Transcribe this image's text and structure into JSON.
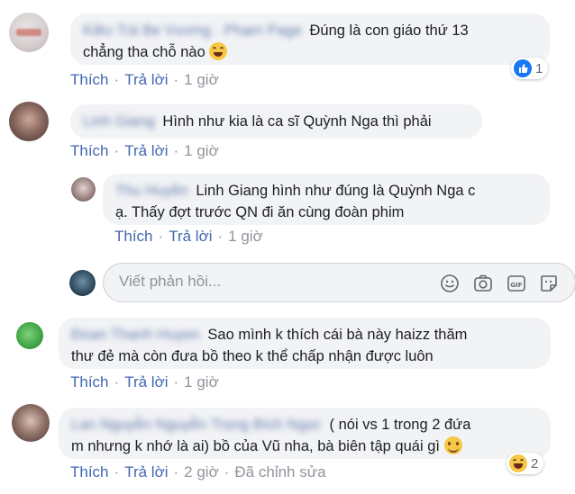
{
  "comments": [
    {
      "author": "Kiều Trà Be Vương · Phạm Page",
      "text_line1": "Đúng là con giáo thứ 13",
      "text_line2": "chẳng tha chỗ nào",
      "actions": {
        "like": "Thích",
        "reply": "Trả lời",
        "time": "1 giờ"
      },
      "reaction": {
        "icon": "like-reaction-icon",
        "count": "1",
        "color": "#1877f2"
      }
    },
    {
      "author": "Linh Giang",
      "text_line1": "Hình như kia là ca sĩ Quỳnh Nga thì phải",
      "actions": {
        "like": "Thích",
        "reply": "Trả lời",
        "time": "1 giờ"
      }
    },
    {
      "author": "Thu Huyền",
      "text_line1": "Linh Giang hình như đúng là Quỳnh Nga c",
      "text_line2": "ạ. Thấy đợt trước QN đi ăn cùng đoàn phim",
      "actions": {
        "like": "Thích",
        "reply": "Trả lời",
        "time": "1 giờ"
      }
    },
    {
      "author": "Đoan Thanh Huyen",
      "text_line1": "Sao mình k thích cái bà này haizz thăm",
      "text_line2": "thư đẻ mà còn đưa bồ theo k thể chấp nhận được luôn",
      "actions": {
        "like": "Thích",
        "reply": "Trả lời",
        "time": "1 giờ"
      }
    },
    {
      "author": "Lan Nguyễn Nguyễn Trọng Bích Ngọc",
      "text_line1": "( nói vs 1 trong 2 đứa",
      "text_line2": "m nhưng k nhớ là ai) bồ của Vũ nha, bà biên tập quái gì",
      "actions": {
        "like": "Thích",
        "reply": "Trả lời",
        "time": "2 giờ",
        "edited": "Đã chỉnh sửa"
      },
      "reaction": {
        "icon": "haha-reaction-icon",
        "count": "2",
        "color": "#f7c748"
      }
    }
  ],
  "reply_box": {
    "placeholder": "Viết phản hồi...",
    "tools": [
      "emoji-icon",
      "camera-icon",
      "gif-icon",
      "sticker-icon"
    ]
  },
  "colors": {
    "link": "#4267b2",
    "bubble": "#f2f3f5",
    "meta": "#90949c"
  }
}
